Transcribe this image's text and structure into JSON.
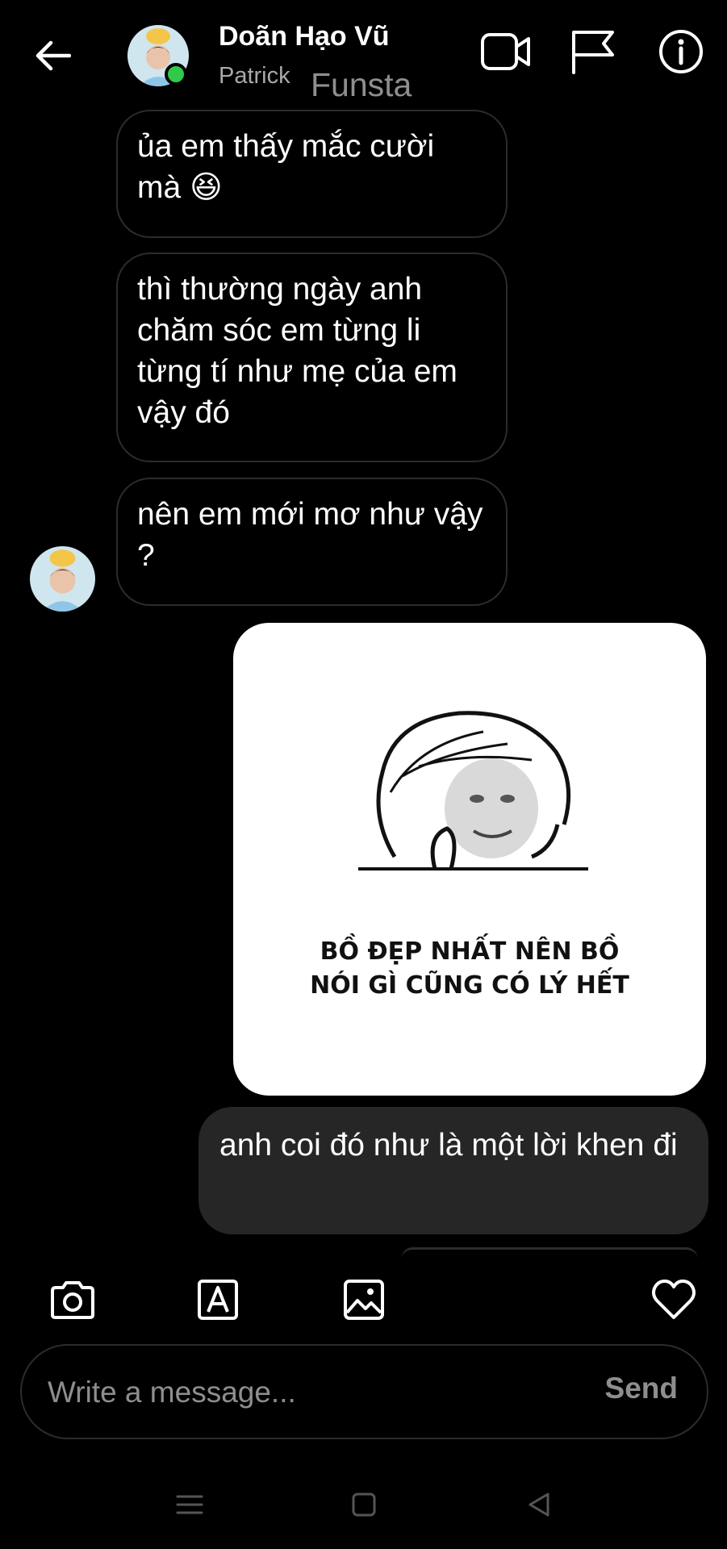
{
  "header": {
    "name": "Doãn Hạo Vũ",
    "subtitle": "Patrick",
    "overlay_text": "Funsta",
    "online": true,
    "status_color": "#31c94b",
    "icons": [
      "back-arrow-icon",
      "video-call-icon",
      "flag-icon",
      "info-icon"
    ]
  },
  "messages": [
    {
      "from": "them",
      "text": "ủa em thấy mắc cười mà 😆"
    },
    {
      "from": "them",
      "text": "thì thường ngày anh chăm sóc em từng li từng tí như mẹ của em vậy đó"
    },
    {
      "from": "them",
      "text": "nên em mới mơ như vậy ?"
    },
    {
      "from": "me",
      "type": "sticker",
      "sticker_lines": [
        "BỒ ĐẸP NHẤT NÊN BỒ",
        "NÓI GÌ CŨNG CÓ LÝ HẾT"
      ]
    },
    {
      "from": "me",
      "text": "anh coi đó  như là một lời khen đi"
    }
  ],
  "toolbar": {
    "icons": [
      "camera-icon",
      "text-style-icon",
      "gallery-icon",
      "heart-icon"
    ]
  },
  "composer": {
    "placeholder": "Write a message...",
    "value": "",
    "send_label": "Send"
  },
  "nav": {
    "icons": [
      "menu-icon",
      "home-square-icon",
      "back-triangle-icon"
    ]
  },
  "colors": {
    "background": "#000000",
    "outgoing_bubble": "#262626",
    "incoming_border": "#2c2c2c",
    "muted_text": "#8e8e8e"
  }
}
